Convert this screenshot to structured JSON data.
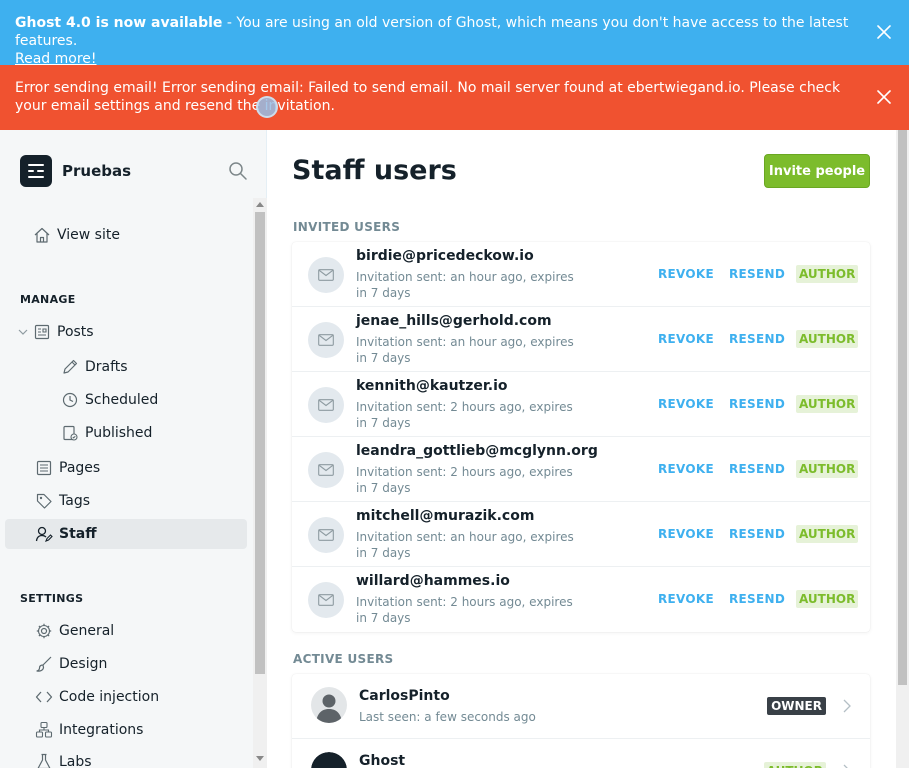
{
  "update_banner": {
    "title": "Ghost 4.0 is now available",
    "message": " - You are using an old version of Ghost, which means you don't have access to the latest features.",
    "link": "Read more!"
  },
  "error_banner": {
    "message": "Error sending email! Error sending email: Failed to send email. No mail server found at ebertwiegand.io. Please check your email settings and resend the invitation."
  },
  "sidebar": {
    "site_name": "Pruebas",
    "view_site": "View site",
    "manage_heading": "MANAGE",
    "settings_heading": "SETTINGS",
    "manage_items": {
      "posts": "Posts",
      "drafts": "Drafts",
      "scheduled": "Scheduled",
      "published": "Published",
      "pages": "Pages",
      "tags": "Tags",
      "staff": "Staff"
    },
    "settings_items": {
      "general": "General",
      "design": "Design",
      "code_injection": "Code injection",
      "integrations": "Integrations",
      "labs": "Labs"
    }
  },
  "main": {
    "title": "Staff users",
    "invite_button": "Invite people",
    "invited_heading": "INVITED USERS",
    "active_heading": "ACTIVE USERS",
    "revoke_label": "REVOKE",
    "resend_label": "RESEND",
    "invited_users": [
      {
        "email": "birdie@pricedeckow.io",
        "meta": "Invitation sent: an hour ago, expires in 7 days",
        "role": "AUTHOR"
      },
      {
        "email": "jenae_hills@gerhold.com",
        "meta": "Invitation sent: an hour ago, expires in 7 days",
        "role": "AUTHOR"
      },
      {
        "email": "kennith@kautzer.io",
        "meta": "Invitation sent: 2 hours ago, expires in 7 days",
        "role": "AUTHOR"
      },
      {
        "email": "leandra_gottlieb@mcglynn.org",
        "meta": "Invitation sent: 2 hours ago, expires in 7 days",
        "role": "AUTHOR"
      },
      {
        "email": "mitchell@murazik.com",
        "meta": "Invitation sent: an hour ago, expires in 7 days",
        "role": "AUTHOR"
      },
      {
        "email": "willard@hammes.io",
        "meta": "Invitation sent: 2 hours ago, expires in 7 days",
        "role": "AUTHOR"
      }
    ],
    "active_users": [
      {
        "name": "CarlosPinto",
        "last_seen": "Last seen: a few seconds ago",
        "role": "OWNER"
      },
      {
        "name": "Ghost",
        "last_seen": "",
        "role": "AUTHOR"
      }
    ]
  },
  "colors": {
    "update_banner": "#3eb0ef",
    "error_banner": "#f05230",
    "accent_green": "#7cbc2c",
    "link_blue": "#3eb0ef"
  }
}
